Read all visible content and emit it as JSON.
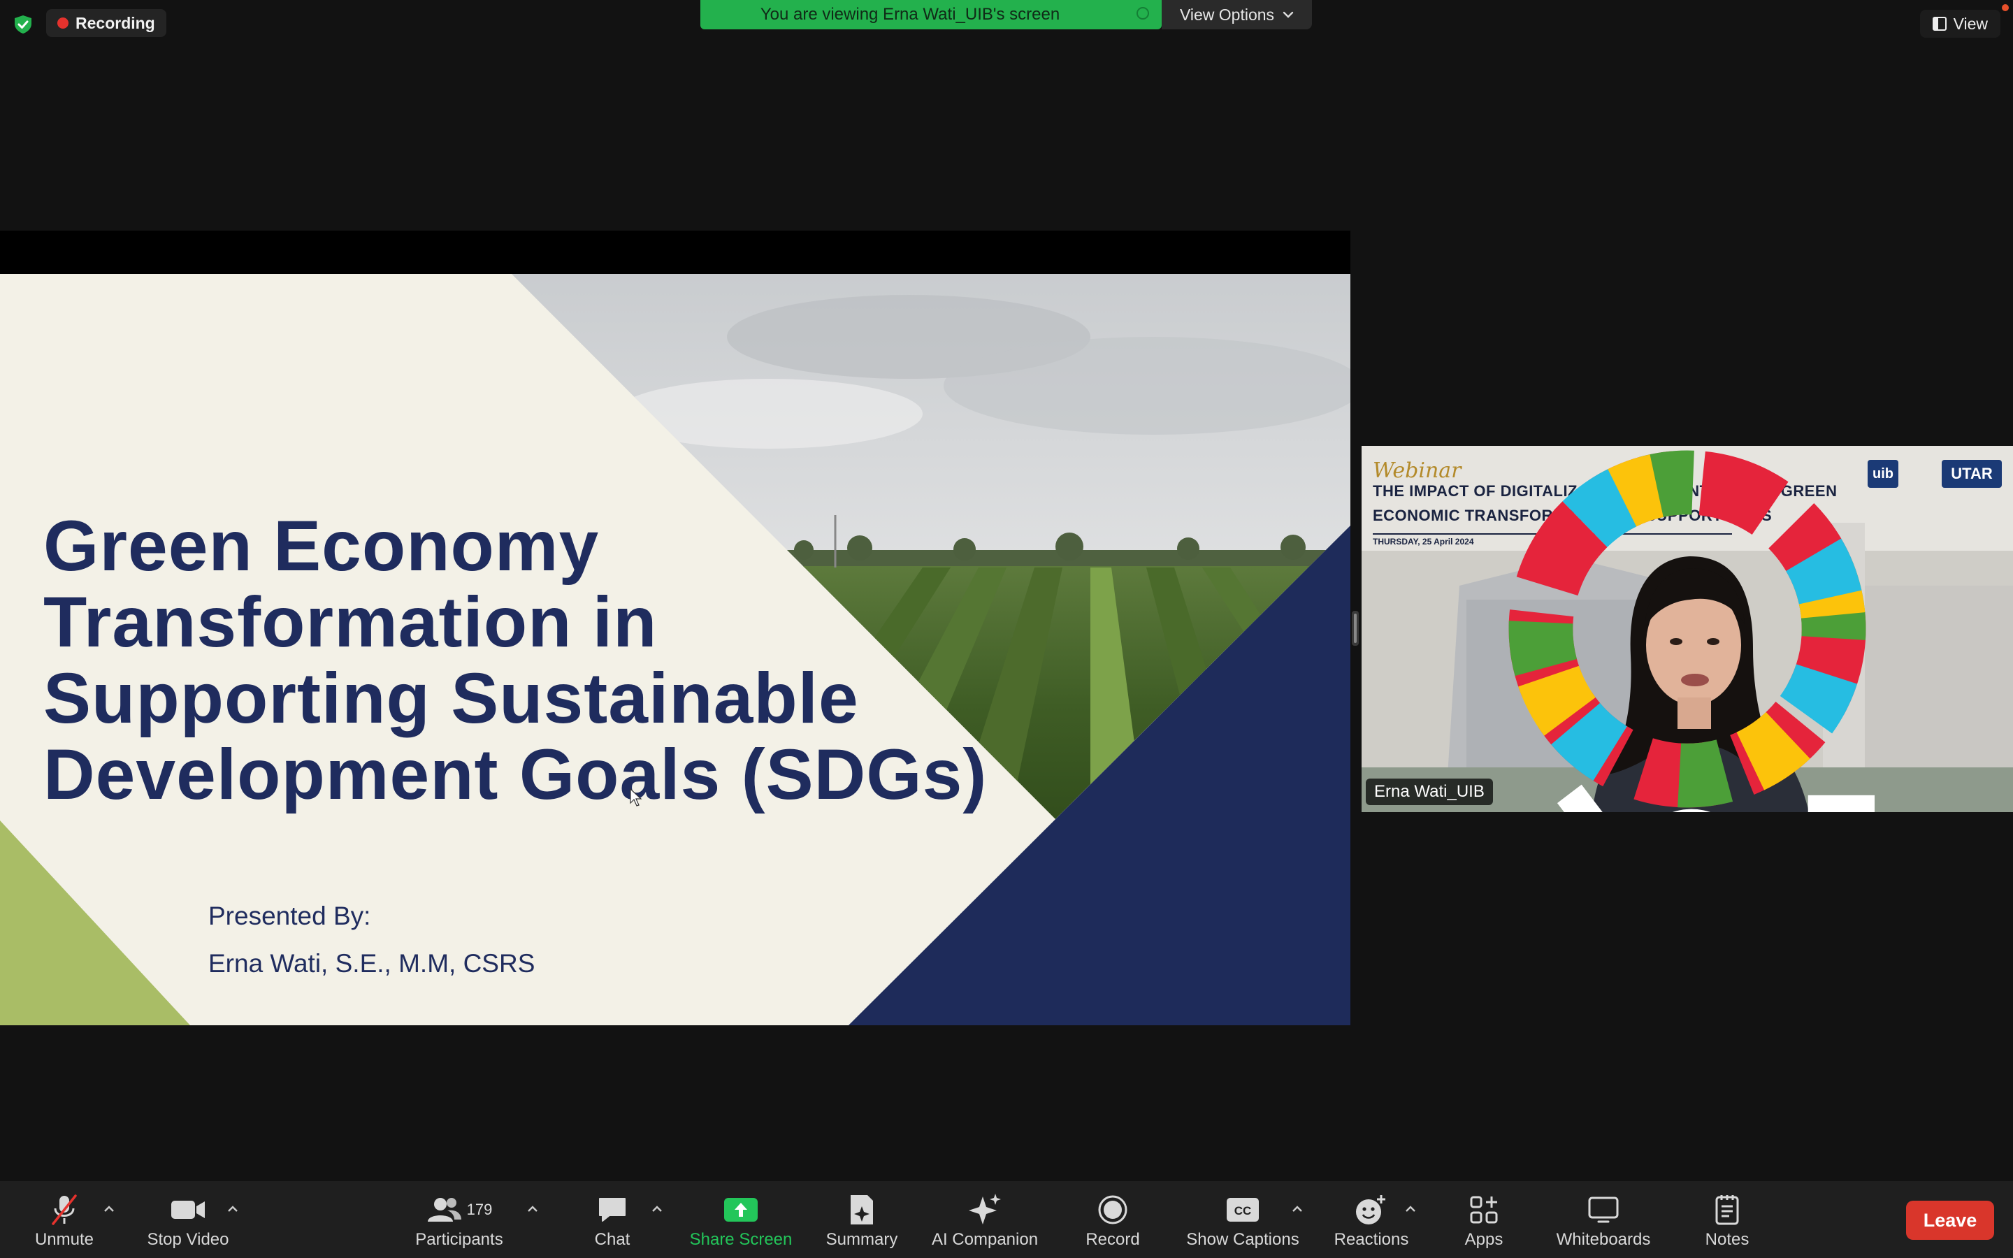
{
  "top_bar": {
    "recording_label": "Recording",
    "viewing_banner": "You are viewing Erna Wati_UIB's screen",
    "view_options_label": "View Options",
    "view_label": "View"
  },
  "slide": {
    "title_lines": [
      "Green Economy",
      "Transformation in",
      "Supporting Sustainable",
      "Development Goals (SDGs)"
    ],
    "presented_by_label": "Presented By:",
    "presenter_name": "Erna Wati, S.E., M.M, CSRS"
  },
  "video": {
    "background_header": "Webinar",
    "background_title_line1": "THE IMPACT OF DIGITALIZATION ACCOUNTING AND GREEN",
    "background_title_line2": "ECONOMIC TRANSFORMATION TO SUPPORT SDGS",
    "background_date": "THURSDAY, 25 April 2024",
    "logo_uib": "uib",
    "logo_utar": "UTAR",
    "participant_name": "Erna Wati_UIB"
  },
  "toolbar": {
    "unmute": "Unmute",
    "stop_video": "Stop Video",
    "participants": "Participants",
    "participants_count": "179",
    "chat": "Chat",
    "share_screen": "Share Screen",
    "summary": "Summary",
    "ai_companion": "AI Companion",
    "record": "Record",
    "show_captions": "Show Captions",
    "reactions": "Reactions",
    "apps": "Apps",
    "whiteboards": "Whiteboards",
    "notes": "Notes",
    "leave": "Leave"
  },
  "colors": {
    "banner_green": "#23b14d",
    "slide_navy": "#1f2c5e",
    "slide_olive": "#a9bd66",
    "leave_red": "#d9362b"
  }
}
